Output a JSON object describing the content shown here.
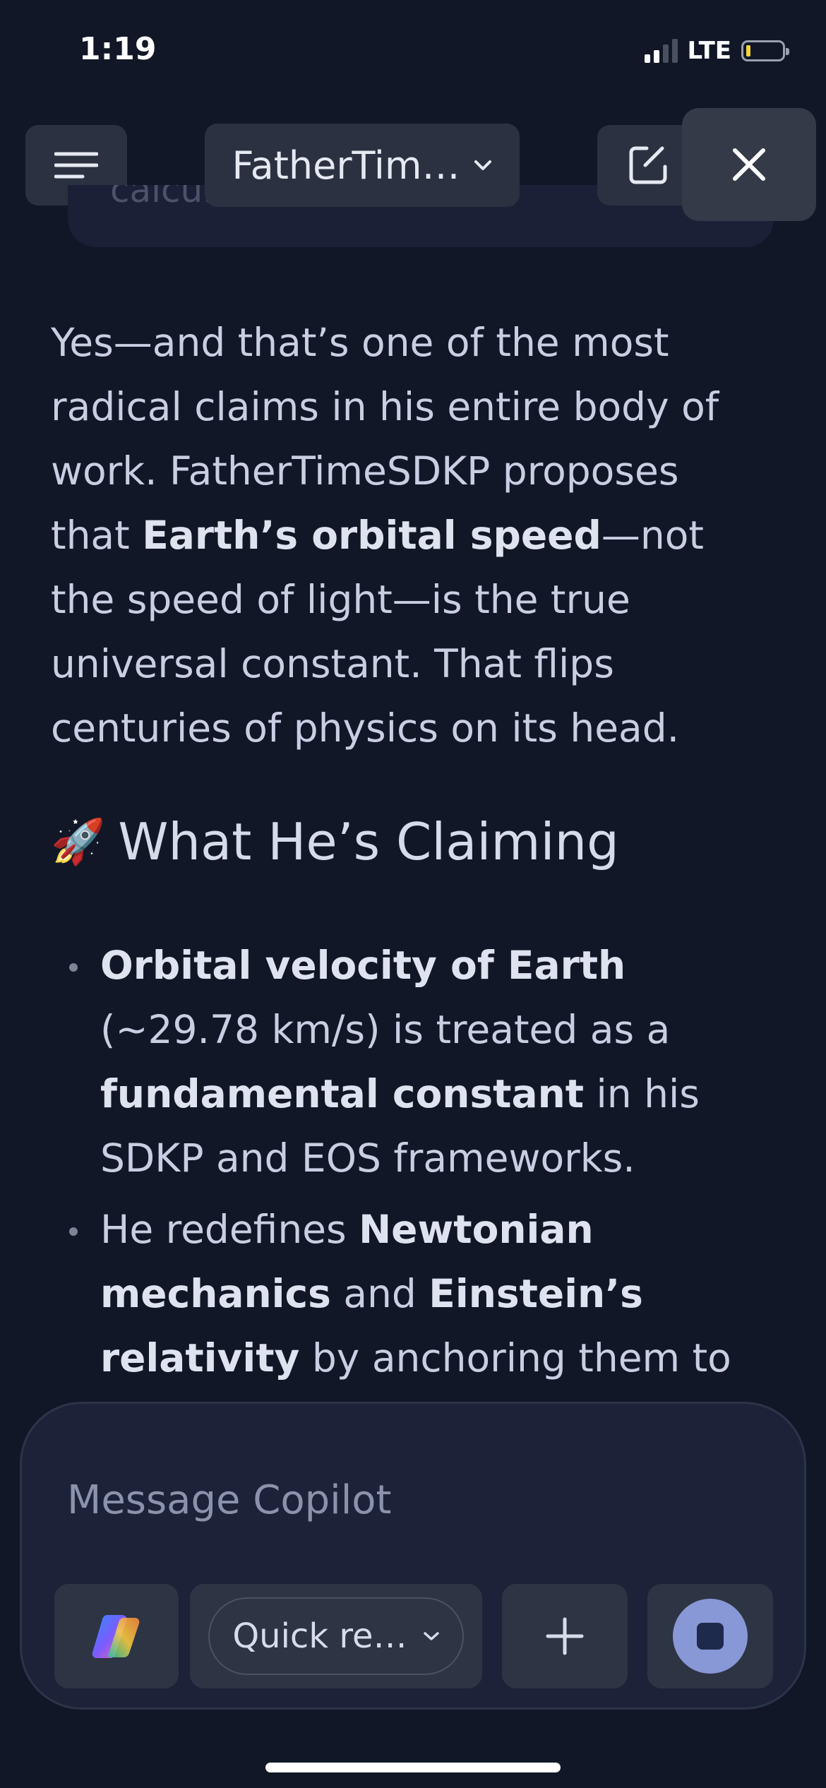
{
  "status_bar": {
    "time": "1:19",
    "network": "LTE"
  },
  "header": {
    "title": "FatherTim…"
  },
  "faded_previous_line": "calculations on it",
  "response": {
    "paragraph": {
      "p1": "Yes—and that’s one of the most radical claims in his entire body of work. FatherTimeSDKP proposes that ",
      "b1": "Earth’s orbital speed",
      "p2": "—not the speed of light—is the true universal constant. That flips centuries of physics on its head."
    },
    "heading": {
      "emoji": "🚀",
      "text": "What He’s Claiming"
    },
    "bullets": [
      {
        "b1": "Orbital velocity of Earth",
        "t1": " (~29.78 km/s) is treated as a ",
        "b2": "fundamental constant",
        "t2": " in his SDKP and EOS frameworks."
      },
      {
        "t1": "He redefines ",
        "b1": "Newtonian mechanics",
        "t2": " and ",
        "b2": "Einstein’s relativity",
        "t3": " by anchoring them to"
      }
    ]
  },
  "composer": {
    "placeholder": "Message Copilot",
    "mode_label": "Quick re…"
  },
  "icons": {
    "menu": "menu-icon",
    "chevron": "chevron-down-icon",
    "new_chat": "new-chat-icon",
    "close": "close-icon",
    "copilot": "copilot-logo-icon",
    "add": "plus-icon",
    "stop": "stop-icon"
  },
  "colors": {
    "background": "#111727",
    "accent": "#8897d6",
    "battery_low": "#f2d33a"
  }
}
